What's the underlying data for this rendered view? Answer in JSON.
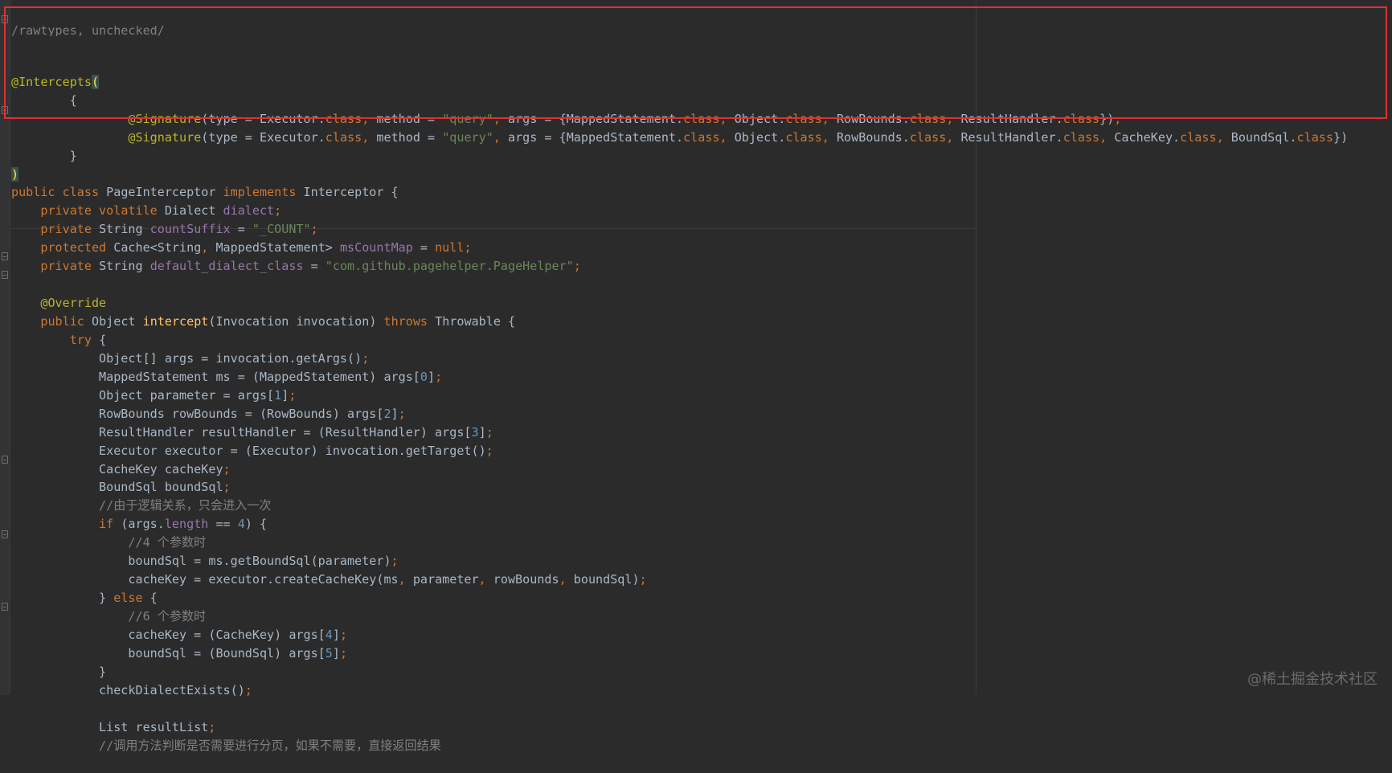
{
  "editor": {
    "top_comment": "/rawtypes, unchecked/",
    "lines": [
      [
        [
          "ann",
          "@Intercepts"
        ],
        [
          "brk",
          "("
        ]
      ],
      [
        [
          "txt",
          "        {"
        ]
      ],
      [
        [
          "txt",
          "                "
        ],
        [
          "ann",
          "@Signature"
        ],
        [
          "txt",
          "(type = Executor."
        ],
        [
          "kw",
          "class"
        ],
        [
          "kw",
          ", "
        ],
        [
          "txt",
          "method = "
        ],
        [
          "str",
          "\"query\""
        ],
        [
          "kw",
          ", "
        ],
        [
          "txt",
          "args = {MappedStatement."
        ],
        [
          "kw",
          "class"
        ],
        [
          "kw",
          ", "
        ],
        [
          "txt",
          "Object."
        ],
        [
          "kw",
          "class"
        ],
        [
          "kw",
          ", "
        ],
        [
          "txt",
          "RowBounds."
        ],
        [
          "kw",
          "class"
        ],
        [
          "kw",
          ", "
        ],
        [
          "txt",
          "ResultHandler."
        ],
        [
          "kw",
          "class"
        ],
        [
          "txt",
          "})"
        ],
        [
          "kw",
          ","
        ]
      ],
      [
        [
          "txt",
          "                "
        ],
        [
          "ann",
          "@Signature"
        ],
        [
          "txt",
          "(type = Executor."
        ],
        [
          "kw",
          "class"
        ],
        [
          "kw",
          ", "
        ],
        [
          "txt",
          "method = "
        ],
        [
          "str",
          "\"query\""
        ],
        [
          "kw",
          ", "
        ],
        [
          "txt",
          "args = {MappedStatement."
        ],
        [
          "kw",
          "class"
        ],
        [
          "kw",
          ", "
        ],
        [
          "txt",
          "Object."
        ],
        [
          "kw",
          "class"
        ],
        [
          "kw",
          ", "
        ],
        [
          "txt",
          "RowBounds."
        ],
        [
          "kw",
          "class"
        ],
        [
          "kw",
          ", "
        ],
        [
          "txt",
          "ResultHandler."
        ],
        [
          "kw",
          "class"
        ],
        [
          "kw",
          ", "
        ],
        [
          "txt",
          "CacheKey."
        ],
        [
          "kw",
          "class"
        ],
        [
          "kw",
          ", "
        ],
        [
          "txt",
          "BoundSql."
        ],
        [
          "kw",
          "class"
        ],
        [
          "txt",
          "})"
        ]
      ],
      [
        [
          "txt",
          "        }"
        ]
      ],
      [
        [
          "brk",
          ")"
        ]
      ],
      [
        [
          "kw",
          "public class "
        ],
        [
          "txt",
          "PageInterceptor "
        ],
        [
          "kw",
          "implements "
        ],
        [
          "txt",
          "Interceptor {"
        ]
      ],
      [
        [
          "txt",
          "    "
        ],
        [
          "kw",
          "private volatile "
        ],
        [
          "txt",
          "Dialect "
        ],
        [
          "fld",
          "dialect"
        ],
        [
          "kw",
          ";"
        ]
      ],
      [
        [
          "txt",
          "    "
        ],
        [
          "kw",
          "private "
        ],
        [
          "txt",
          "String "
        ],
        [
          "fld",
          "countSuffix"
        ],
        [
          "txt",
          " = "
        ],
        [
          "str",
          "\"_COUNT\""
        ],
        [
          "kw",
          ";"
        ]
      ],
      [
        [
          "txt",
          "    "
        ],
        [
          "kw",
          "protected "
        ],
        [
          "txt",
          "Cache<String"
        ],
        [
          "kw",
          ", "
        ],
        [
          "txt",
          "MappedStatement> "
        ],
        [
          "fld",
          "msCountMap"
        ],
        [
          "txt",
          " = "
        ],
        [
          "kw",
          "null;"
        ]
      ],
      [
        [
          "txt",
          "    "
        ],
        [
          "kw",
          "private "
        ],
        [
          "txt",
          "String "
        ],
        [
          "fld",
          "default_dialect_class"
        ],
        [
          "txt",
          " = "
        ],
        [
          "str",
          "\"com.github.pagehelper.PageHelper\""
        ],
        [
          "kw",
          ";"
        ]
      ],
      [
        [
          "txt",
          ""
        ]
      ],
      [
        [
          "txt",
          "    "
        ],
        [
          "ann",
          "@Override"
        ]
      ],
      [
        [
          "txt",
          "    "
        ],
        [
          "kw",
          "public "
        ],
        [
          "txt",
          "Object "
        ],
        [
          "fn",
          "intercept"
        ],
        [
          "txt",
          "(Invocation invocation) "
        ],
        [
          "kw",
          "throws "
        ],
        [
          "txt",
          "Throwable {"
        ]
      ],
      [
        [
          "txt",
          "        "
        ],
        [
          "kw",
          "try "
        ],
        [
          "txt",
          "{"
        ]
      ],
      [
        [
          "txt",
          "            Object[] args = invocation.getArgs()"
        ],
        [
          "kw",
          ";"
        ]
      ],
      [
        [
          "txt",
          "            MappedStatement ms = (MappedStatement) args["
        ],
        [
          "num",
          "0"
        ],
        [
          "txt",
          "]"
        ],
        [
          "kw",
          ";"
        ]
      ],
      [
        [
          "txt",
          "            Object parameter = args["
        ],
        [
          "num",
          "1"
        ],
        [
          "txt",
          "]"
        ],
        [
          "kw",
          ";"
        ]
      ],
      [
        [
          "txt",
          "            RowBounds rowBounds = (RowBounds) args["
        ],
        [
          "num",
          "2"
        ],
        [
          "txt",
          "]"
        ],
        [
          "kw",
          ";"
        ]
      ],
      [
        [
          "txt",
          "            ResultHandler resultHandler = (ResultHandler) args["
        ],
        [
          "num",
          "3"
        ],
        [
          "txt",
          "]"
        ],
        [
          "kw",
          ";"
        ]
      ],
      [
        [
          "txt",
          "            Executor executor = (Executor) invocation.getTarget()"
        ],
        [
          "kw",
          ";"
        ]
      ],
      [
        [
          "txt",
          "            CacheKey cacheKey"
        ],
        [
          "kw",
          ";"
        ]
      ],
      [
        [
          "txt",
          "            BoundSql boundSql"
        ],
        [
          "kw",
          ";"
        ]
      ],
      [
        [
          "txt",
          "            "
        ],
        [
          "cmt",
          "//由于逻辑关系，只会进入一次"
        ]
      ],
      [
        [
          "txt",
          "            "
        ],
        [
          "kw",
          "if "
        ],
        [
          "txt",
          "(args."
        ],
        [
          "fld",
          "length"
        ],
        [
          "txt",
          " == "
        ],
        [
          "num",
          "4"
        ],
        [
          "txt",
          ") {"
        ]
      ],
      [
        [
          "txt",
          "                "
        ],
        [
          "cmt",
          "//4 个参数时"
        ]
      ],
      [
        [
          "txt",
          "                boundSql = ms.getBoundSql(parameter)"
        ],
        [
          "kw",
          ";"
        ]
      ],
      [
        [
          "txt",
          "                cacheKey = executor.createCacheKey(ms"
        ],
        [
          "kw",
          ", "
        ],
        [
          "txt",
          "parameter"
        ],
        [
          "kw",
          ", "
        ],
        [
          "txt",
          "rowBounds"
        ],
        [
          "kw",
          ", "
        ],
        [
          "txt",
          "boundSql)"
        ],
        [
          "kw",
          ";"
        ]
      ],
      [
        [
          "txt",
          "            } "
        ],
        [
          "kw",
          "else "
        ],
        [
          "txt",
          "{"
        ]
      ],
      [
        [
          "txt",
          "                "
        ],
        [
          "cmt",
          "//6 个参数时"
        ]
      ],
      [
        [
          "txt",
          "                cacheKey = (CacheKey) args["
        ],
        [
          "num",
          "4"
        ],
        [
          "txt",
          "]"
        ],
        [
          "kw",
          ";"
        ]
      ],
      [
        [
          "txt",
          "                boundSql = (BoundSql) args["
        ],
        [
          "num",
          "5"
        ],
        [
          "txt",
          "]"
        ],
        [
          "kw",
          ";"
        ]
      ],
      [
        [
          "txt",
          "            }"
        ]
      ],
      [
        [
          "txt",
          "            checkDialectExists()"
        ],
        [
          "kw",
          ";"
        ]
      ],
      [
        [
          "txt",
          ""
        ]
      ],
      [
        [
          "txt",
          "            List resultList"
        ],
        [
          "kw",
          ";"
        ]
      ],
      [
        [
          "txt",
          "            "
        ],
        [
          "cmt",
          "//调用方法判断是否需要进行分页，如果不需要，直接返回结果"
        ]
      ]
    ]
  },
  "watermark": "@稀土掘金技术社区",
  "colors": {
    "background": "#2b2b2b",
    "keyword": "#cc7832",
    "annotation": "#bbb529",
    "string": "#6a8759",
    "number": "#6897bb",
    "field": "#9876aa",
    "method": "#ffc66d",
    "comment": "#808080",
    "text": "#a9b7c6",
    "highlight_box": "#e03030"
  }
}
